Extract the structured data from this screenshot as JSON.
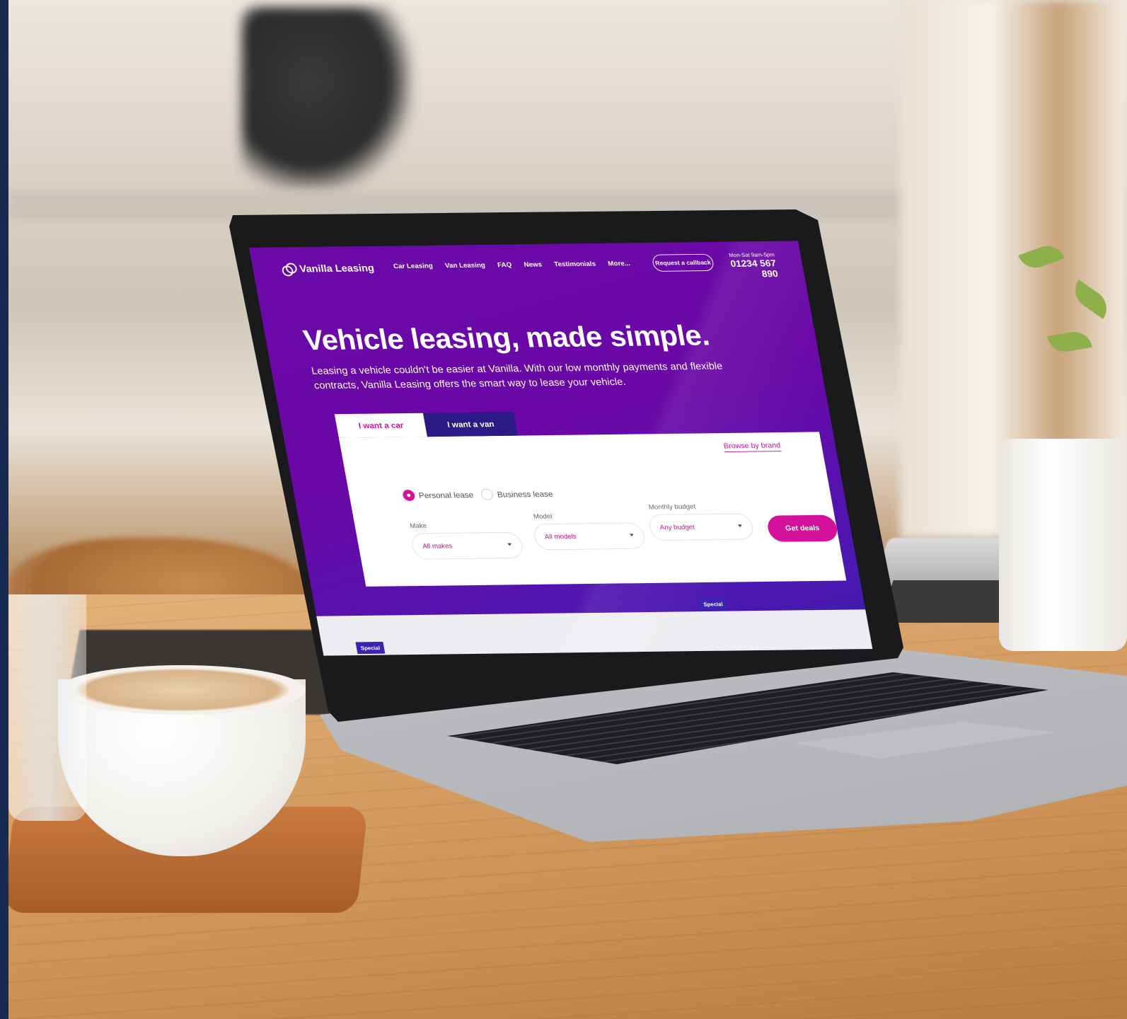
{
  "site": {
    "brand": "Vanilla Leasing",
    "nav": [
      "Car Leasing",
      "Van Leasing",
      "FAQ",
      "News",
      "Testimonials",
      "More..."
    ],
    "callback_label": "Request a callback",
    "hours": "Mon-Sat 9am-5pm",
    "phone": "01234 567 890"
  },
  "hero": {
    "title": "Vehicle leasing, made simple.",
    "description": "Leasing a vehicle couldn't be easier at Vanilla. With our low monthly payments and flexible contracts, Vanilla Leasing offers the smart way to lease your vehicle."
  },
  "search": {
    "tabs": [
      "I want a car",
      "I want a van"
    ],
    "active_tab": "I want a car",
    "browse_label": "Browse by brand",
    "lease_types": [
      "Personal lease",
      "Business lease"
    ],
    "selected_lease": "Personal lease",
    "make_label": "Make",
    "make_value": "All makes",
    "model_label": "Model",
    "model_value": "All models",
    "budget_label": "Monthly budget",
    "budget_value": "Any budget",
    "submit_label": "Get deals"
  },
  "badges": {
    "special": "Special"
  },
  "colors": {
    "primary": "#6a07a6",
    "accent": "#d4119a",
    "tab_dark": "#2b1a86"
  },
  "icons": [
    "vanilla-logo-icon",
    "chevron-down-icon"
  ]
}
